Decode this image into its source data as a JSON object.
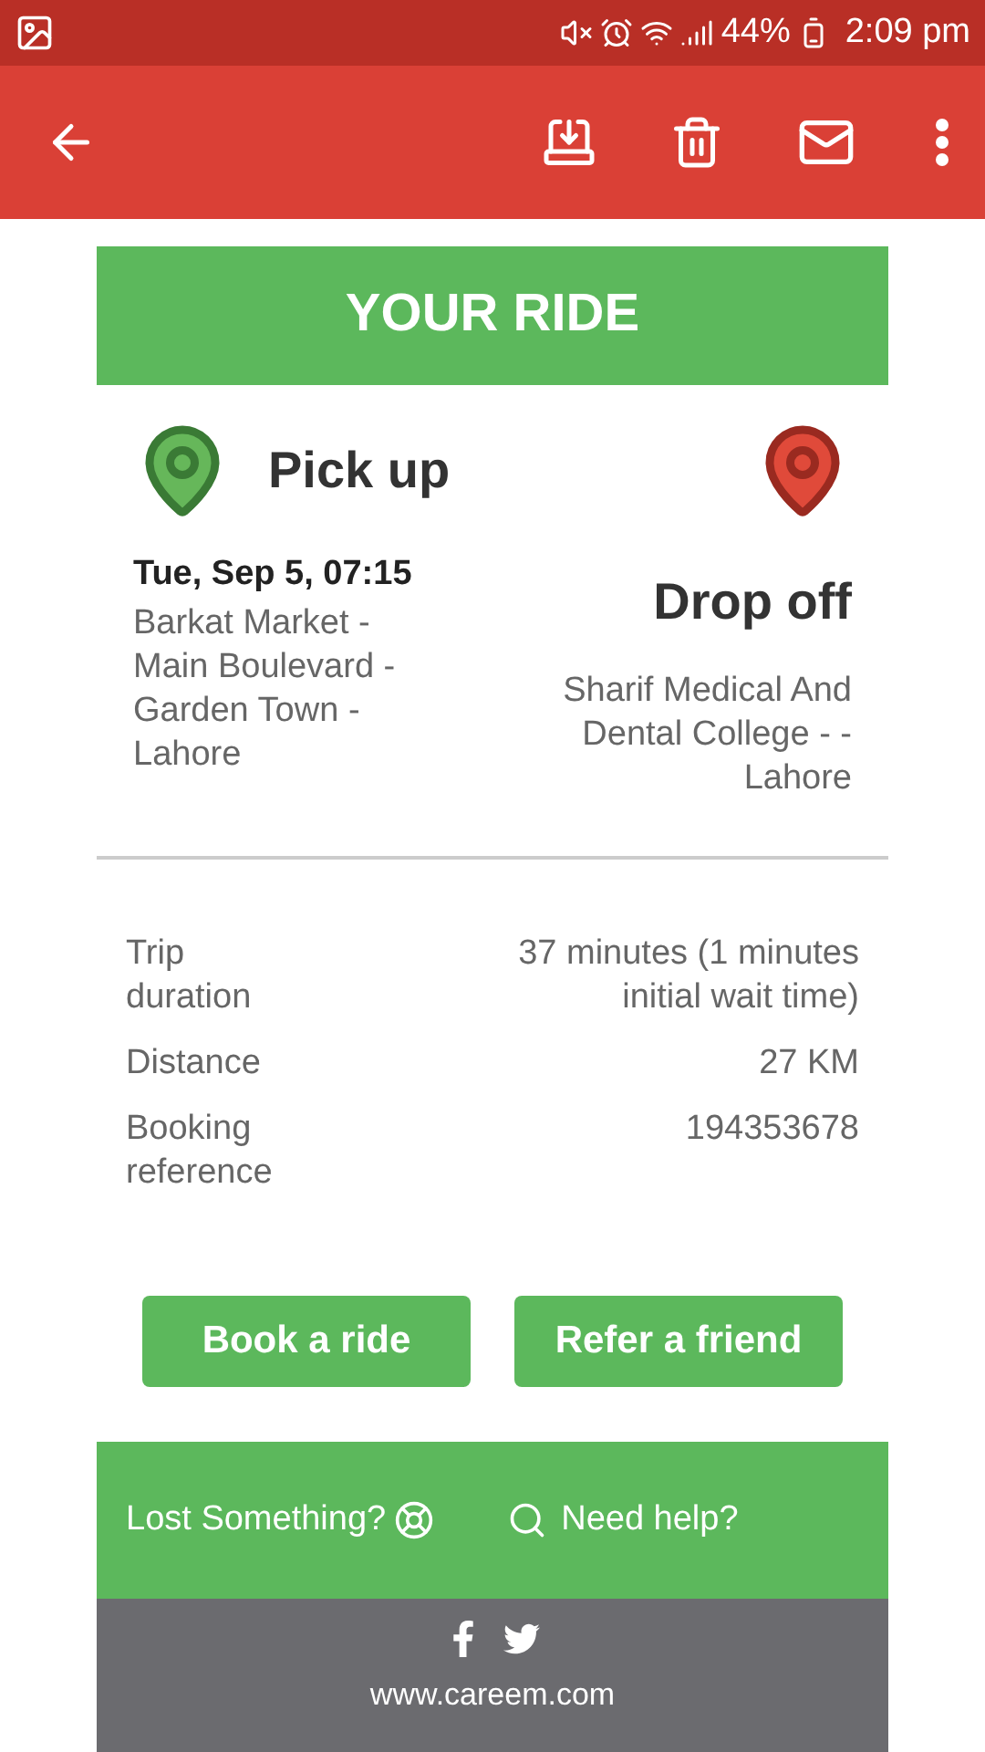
{
  "status_bar": {
    "battery": "44%",
    "time": "2:09 pm"
  },
  "ride": {
    "title": "YOUR RIDE",
    "pickup": {
      "label": "Pick up",
      "datetime": "Tue, Sep 5, 07:15",
      "address": "Barkat Market - Main Boulevard - Garden Town - Lahore"
    },
    "dropoff": {
      "label": "Drop off",
      "address": "Sharif Medical And Dental College - - Lahore"
    }
  },
  "details": [
    {
      "label": "Trip duration",
      "value": "37 minutes (1 minutes initial wait time)"
    },
    {
      "label": "Distance",
      "value": "27 KM"
    },
    {
      "label": "Booking reference",
      "value": "194353678"
    }
  ],
  "buttons": [
    "Book a ride",
    "Refer a friend"
  ],
  "footer": {
    "lost": "Lost Something?",
    "help": "Need help?",
    "website": "www.careem.com"
  }
}
